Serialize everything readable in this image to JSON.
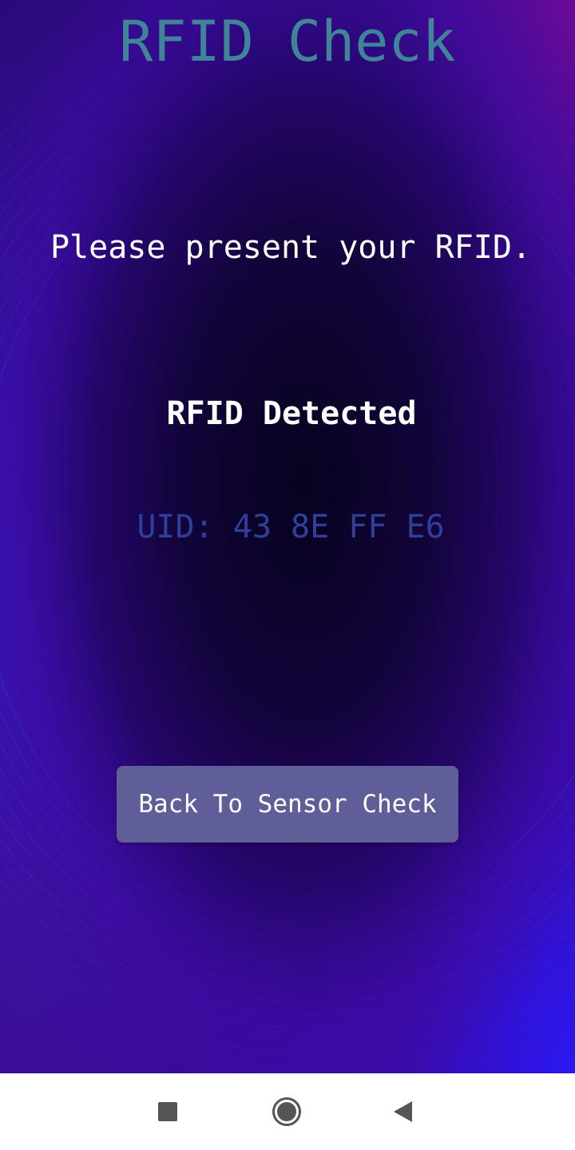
{
  "screen": {
    "title": "RFID Check",
    "prompt": "Please present your RFID.",
    "status": "RFID Detected",
    "uid": "UID: 43 8E FF E6",
    "back_button_label": "Back To Sensor Check"
  },
  "navbar": {
    "recents_icon": "square-icon",
    "home_icon": "circle-icon",
    "back_icon": "triangle-back-icon"
  },
  "colors": {
    "title": "#3f8497",
    "text": "#ffffff",
    "uid": "#2f3f9a",
    "button_bg": "#5f5e98",
    "bg_dark": "#0a0224",
    "bg_purple": "#4a0a9a",
    "bg_blue": "#2a10d0"
  }
}
